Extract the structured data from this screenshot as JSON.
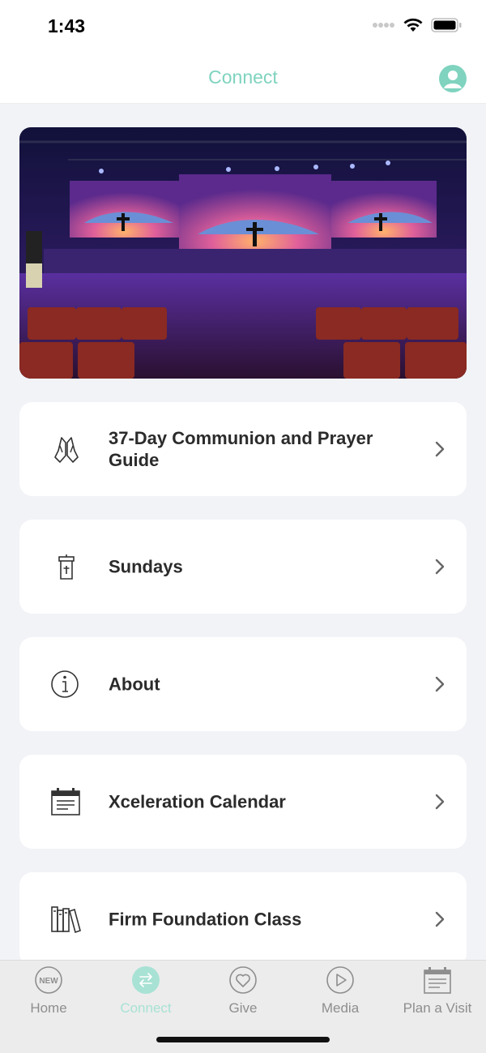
{
  "status_bar": {
    "time": "1:43"
  },
  "nav": {
    "title": "Connect",
    "accent_color": "#7fd3bf"
  },
  "hero": {
    "image": "church-stage-photo"
  },
  "menu": [
    {
      "label": "37-Day Communion and Prayer Guide",
      "icon": "praying-hands-icon"
    },
    {
      "label": "Sundays",
      "icon": "pulpit-icon"
    },
    {
      "label": "About",
      "icon": "info-icon"
    },
    {
      "label": "Xceleration Calendar",
      "icon": "calendar-icon"
    },
    {
      "label": "Firm Foundation Class",
      "icon": "books-icon"
    }
  ],
  "tabs": [
    {
      "label": "Home",
      "icon": "new-badge-icon",
      "badge": "NEW",
      "active": false
    },
    {
      "label": "Connect",
      "icon": "connect-arrows-icon",
      "active": true
    },
    {
      "label": "Give",
      "icon": "heart-icon",
      "active": false
    },
    {
      "label": "Media",
      "icon": "play-icon",
      "active": false
    },
    {
      "label": "Plan a Visit",
      "icon": "calendar-icon",
      "active": false
    }
  ]
}
